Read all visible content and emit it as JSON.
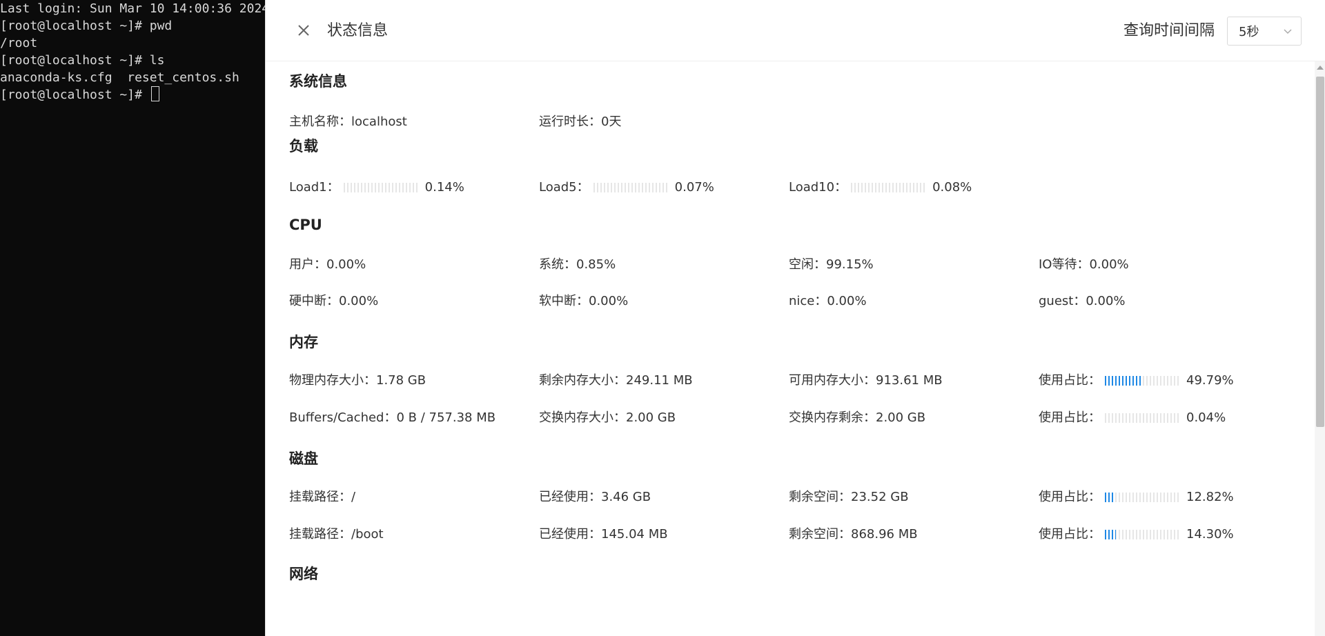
{
  "terminal": {
    "lines": [
      "Last login: Sun Mar 10 14:00:36 2024",
      "[root@localhost ~]# pwd",
      "/root",
      "[root@localhost ~]# ls",
      "anaconda-ks.cfg  reset_centos.sh",
      "[root@localhost ~]# "
    ]
  },
  "panel": {
    "title": "状态信息",
    "interval_label": "查询时间间隔",
    "interval_value": "5秒"
  },
  "system": {
    "title": "系统信息",
    "hostname": "主机名称：localhost",
    "uptime": "运行时长：0天"
  },
  "load": {
    "title": "负载",
    "load1_label": "Load1：",
    "load1_value": "0.14%",
    "load1_fraction": 0.0014,
    "load5_label": "Load5：",
    "load5_value": "0.07%",
    "load5_fraction": 0.0007,
    "load10_label": "Load10：",
    "load10_value": "0.08%",
    "load10_fraction": 0.0008
  },
  "cpu": {
    "title": "CPU",
    "user": "用户：0.00%",
    "system": "系统：0.85%",
    "idle": "空闲：99.15%",
    "iowait": "IO等待：0.00%",
    "irq": "硬中断：0.00%",
    "softirq": "软中断：0.00%",
    "nice": "nice：0.00%",
    "guest": "guest：0.00%"
  },
  "memory": {
    "title": "内存",
    "physical": "物理内存大小：1.78 GB",
    "free": "剩余内存大小：249.11 MB",
    "available": "可用内存大小：913.61 MB",
    "usage_label": "使用占比：",
    "usage_value": "49.79%",
    "usage_fraction": 0.4979,
    "buffers": "Buffers/Cached：0 B / 757.38 MB",
    "swap_total": "交换内存大小：2.00 GB",
    "swap_free": "交换内存剩余：2.00 GB",
    "swap_usage_label": "使用占比：",
    "swap_usage_value": "0.04%",
    "swap_usage_fraction": 0.0004
  },
  "disk": {
    "title": "磁盘",
    "disk1_mount": "挂载路径：/",
    "disk1_used": "已经使用：3.46 GB",
    "disk1_free": "剩余空间：23.52 GB",
    "disk1_usage_label": "使用占比：",
    "disk1_usage_value": "12.82%",
    "disk1_usage_fraction": 0.1282,
    "disk2_mount": "挂载路径：/boot",
    "disk2_used": "已经使用：145.04 MB",
    "disk2_free": "剩余空间：868.96 MB",
    "disk2_usage_label": "使用占比：",
    "disk2_usage_value": "14.30%",
    "disk2_usage_fraction": 0.143
  },
  "network": {
    "title": "网络"
  },
  "icons": {
    "close": "close-icon",
    "dropdown": "chevron-down-icon"
  }
}
